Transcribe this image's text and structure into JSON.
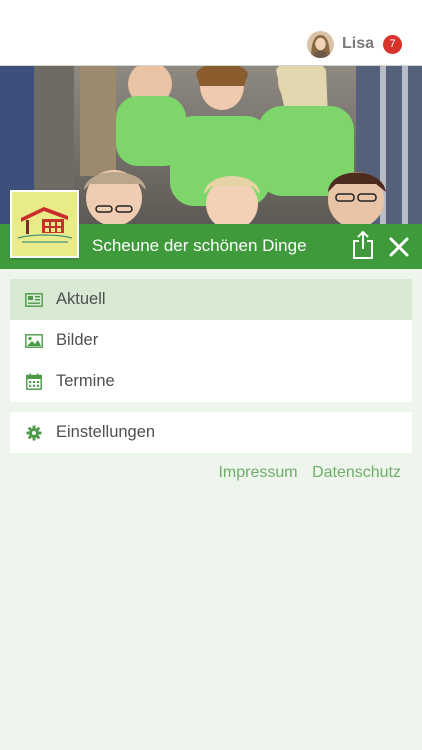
{
  "colors": {
    "brand_green": "#3f9a3b",
    "active_bg": "#d8ead4",
    "badge_red": "#d9322a",
    "icon_green": "#4a9a46",
    "link_green": "#6fae6a",
    "page_bg": "#eef5ec"
  },
  "header": {
    "user_name": "Lisa",
    "notification_count": "7",
    "avatar_icon": "user-avatar"
  },
  "page": {
    "title": "Scheune der schönen Dinge",
    "share_icon": "share-icon",
    "close_icon": "close-icon",
    "logo_caption": "Scheune der schönen Dinge"
  },
  "menu": {
    "primary": [
      {
        "label": "Aktuell",
        "icon": "newspaper-icon",
        "active": true
      },
      {
        "label": "Bilder",
        "icon": "image-icon",
        "active": false
      },
      {
        "label": "Termine",
        "icon": "calendar-icon",
        "active": false
      }
    ],
    "secondary": [
      {
        "label": "Einstellungen",
        "icon": "gear-icon",
        "active": false
      }
    ]
  },
  "footer": {
    "impressum": "Impressum",
    "datenschutz": "Datenschutz"
  }
}
